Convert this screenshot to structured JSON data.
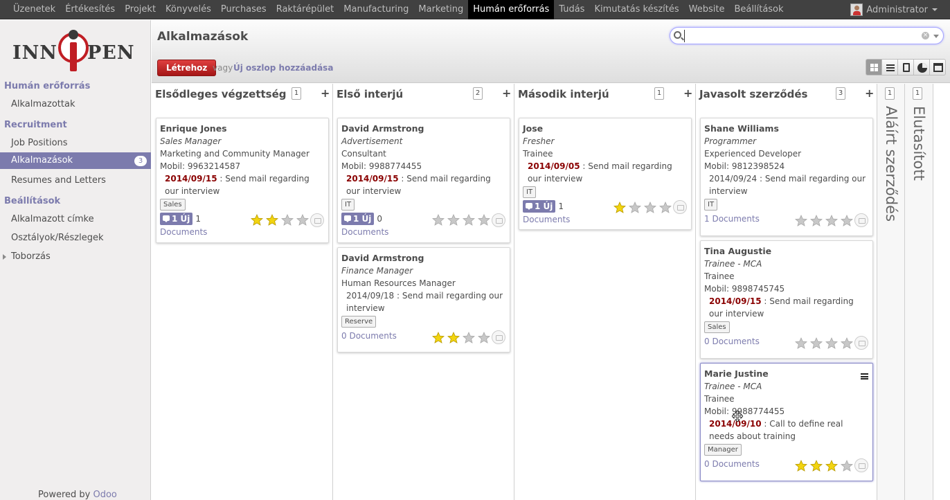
{
  "topmenu": {
    "items": [
      "Üzenetek",
      "Értékesítés",
      "Projekt",
      "Könyvelés",
      "Purchases",
      "Raktárépület",
      "Manufacturing",
      "Marketing",
      "Humán erőforrás",
      "Tudás",
      "Kimutatás készítés",
      "Website",
      "Beállítások"
    ],
    "active_index": 8,
    "user": "Administrator"
  },
  "sidebar": {
    "logo_left": "INN",
    "logo_right": "PEN",
    "sections": [
      {
        "title": "Humán erőforrás",
        "items": [
          {
            "label": "Alkalmazottak"
          }
        ]
      },
      {
        "title": "Recruitment",
        "items": [
          {
            "label": "Job Positions"
          },
          {
            "label": "Alkalmazások",
            "badge": "3",
            "active": true
          },
          {
            "label": "Resumes and Letters"
          }
        ]
      },
      {
        "title": "Beállítások",
        "items": [
          {
            "label": "Alkalmazott címke"
          },
          {
            "label": "Osztályok/Részlegek"
          },
          {
            "label": "Toborzás"
          }
        ]
      }
    ],
    "powered_prefix": "Powered by ",
    "powered_brand": "Odoo"
  },
  "header": {
    "title": "Alkalmazások",
    "create_label": "Létrehoz",
    "or_label": "vagy",
    "add_column_label": "Új oszlop hozzáadása",
    "search_value": ""
  },
  "columns": [
    {
      "title": "Elsődleges végzettség",
      "count": "1",
      "cards": [
        {
          "name": "Enrique Jones",
          "job": "Sales Manager",
          "subject": "Marketing and Community Manager",
          "mobile": "Mobil: 9963214587",
          "act_date": "2014/09/15",
          "act_overdue": true,
          "act_text": ": Send mail regarding our interview",
          "tag": "Sales",
          "new_label": "1 Új",
          "new_count": "1",
          "docs": "Documents",
          "stars": 2
        }
      ]
    },
    {
      "title": "Első interjú",
      "count": "2",
      "cards": [
        {
          "name": "David Armstrong",
          "job": "Advertisement",
          "subject": "Consultant",
          "mobile": "Mobil: 9988774455",
          "act_date": "2014/09/15",
          "act_overdue": true,
          "act_text": ": Send mail regarding our interview",
          "tag": "IT",
          "new_label": "1 Új",
          "new_count": "0",
          "docs": "Documents",
          "stars": 0
        },
        {
          "name": "David Armstrong",
          "job": "Finance Manager",
          "subject": "Human Resources Manager",
          "mobile": "",
          "act_date": "2014/09/18",
          "act_overdue": false,
          "act_text": ": Send mail regarding our interview",
          "tag": "Reserve",
          "docs": "0 Documents",
          "stars": 2
        }
      ]
    },
    {
      "title": "Második interjú",
      "count": "1",
      "cards": [
        {
          "name": "Jose",
          "job": "Fresher",
          "subject": "Trainee",
          "mobile": "",
          "act_date": "2014/09/05",
          "act_overdue": true,
          "act_text": ": Send mail regarding our interview",
          "tag": "IT",
          "new_label": "1 Új",
          "new_count": "1",
          "docs": "Documents",
          "stars": 1
        }
      ]
    },
    {
      "title": "Javasolt szerződés",
      "count": "3",
      "cards": [
        {
          "name": "Shane Williams",
          "job": "Programmer",
          "subject": "Experienced Developer",
          "mobile": "Mobil: 9812398524",
          "act_date": "2014/09/24",
          "act_overdue": false,
          "act_text": ": Send mail regarding our interview",
          "tag": "IT",
          "docs": "1 Documents",
          "stars": 0
        },
        {
          "name": "Tina Augustie",
          "job": "Trainee - MCA",
          "subject": "Trainee",
          "mobile": "Mobil: 9898745745",
          "act_date": "2014/09/15",
          "act_overdue": true,
          "act_text": ": Send mail regarding our interview",
          "tag": "Sales",
          "docs": "0 Documents",
          "stars": 0
        },
        {
          "name": "Marie Justine",
          "job": "Trainee - MCA",
          "subject": "Trainee",
          "mobile": "Mobil: 9988774455",
          "act_date": "2014/09/10",
          "act_overdue": true,
          "act_text": ": Call to define real needs about training",
          "tag": "Manager",
          "docs": "0 Documents",
          "stars": 3
        }
      ]
    }
  ],
  "folded_columns": [
    {
      "title": "Aláírt szerződés",
      "count": "1"
    },
    {
      "title": "Elutasított",
      "count": "1"
    }
  ],
  "colors": {
    "accent": "#7c7bad",
    "create": "#c02a2a",
    "overdue": "#8a0000",
    "star_on": "#f2d410",
    "star_off": "#c8c8c8"
  },
  "icons": {
    "search": "magnifier-icon",
    "star": "star-icon",
    "photo": "camera-icon",
    "menu": "hamburger-icon"
  }
}
